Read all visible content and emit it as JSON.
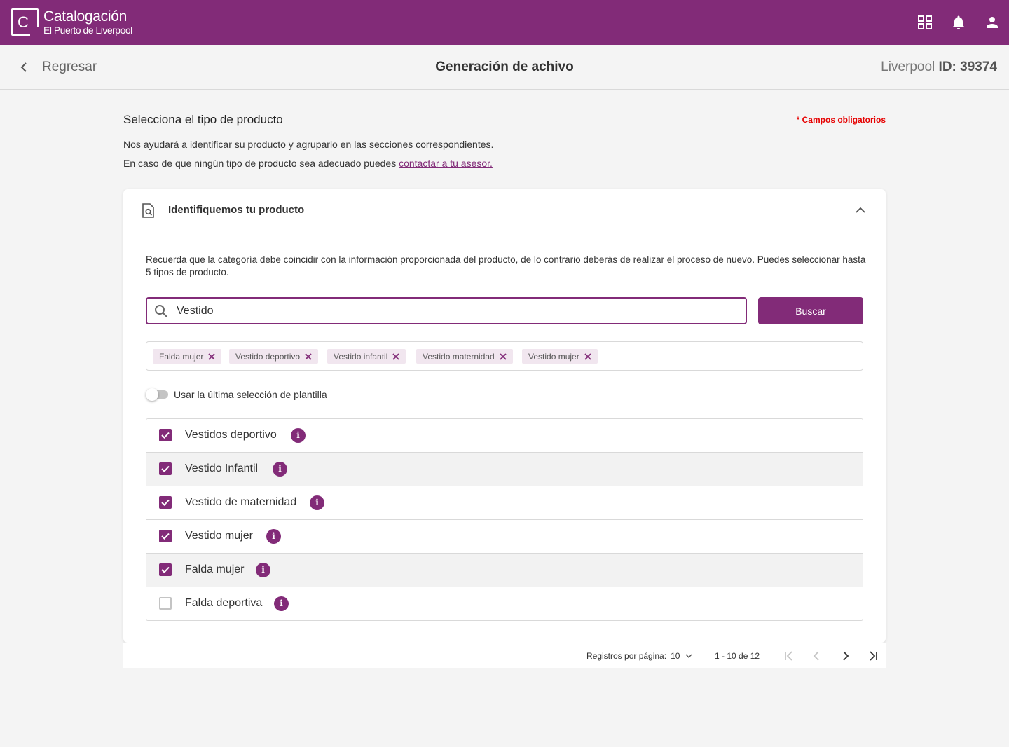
{
  "colors": {
    "primary": "#822b78",
    "required": "#e60000"
  },
  "topbar": {
    "logo_letter": "C",
    "brand_title": "Catalogación",
    "brand_subtitle": "El Puerto de Liverpool",
    "icons": [
      "apps-grid-icon",
      "bell-icon",
      "user-icon"
    ]
  },
  "subheader": {
    "back_label": "Regresar",
    "title": "Generación de achivo",
    "id_prefix": "Liverpool",
    "id_value": "ID: 39374"
  },
  "intro": {
    "title": "Selecciona el tipo de producto",
    "required_note": "* Campos obligatorios",
    "line1": "Nos ayudará a identificar su producto y agruparlo en las secciones correspondientes.",
    "line2": "En caso de que ningún tipo de producto sea adecuado puedes ",
    "link": "contactar a tu asesor."
  },
  "card": {
    "title": "Identifiquemos tu producto",
    "description": "Recuerda que la categoría debe coincidir con la información proporcionada del producto, de lo contrario deberás de realizar el proceso de nuevo. Puedes seleccionar hasta 5 tipos de producto.",
    "search_value": "Vestido",
    "search_button": "Buscar",
    "chips": [
      "Falda mujer",
      "Vestido deportivo",
      "Vestido infantil",
      "Vestido maternidad",
      "Vestido mujer"
    ],
    "toggle_label": "Usar la última selección de plantilla",
    "toggle_on": false,
    "items": [
      {
        "label": "Vestidos deportivo",
        "checked": true
      },
      {
        "label": "Vestido Infantil",
        "checked": true
      },
      {
        "label": "Vestido de maternidad",
        "checked": true
      },
      {
        "label": "Vestido mujer",
        "checked": true
      },
      {
        "label": "Falda mujer",
        "checked": true
      },
      {
        "label": "Falda deportiva",
        "checked": false
      }
    ],
    "info_glyph": "i"
  },
  "pagination": {
    "rows_label": "Registros por página:",
    "rows_value": "10",
    "range": "1 - 10 de 12"
  }
}
